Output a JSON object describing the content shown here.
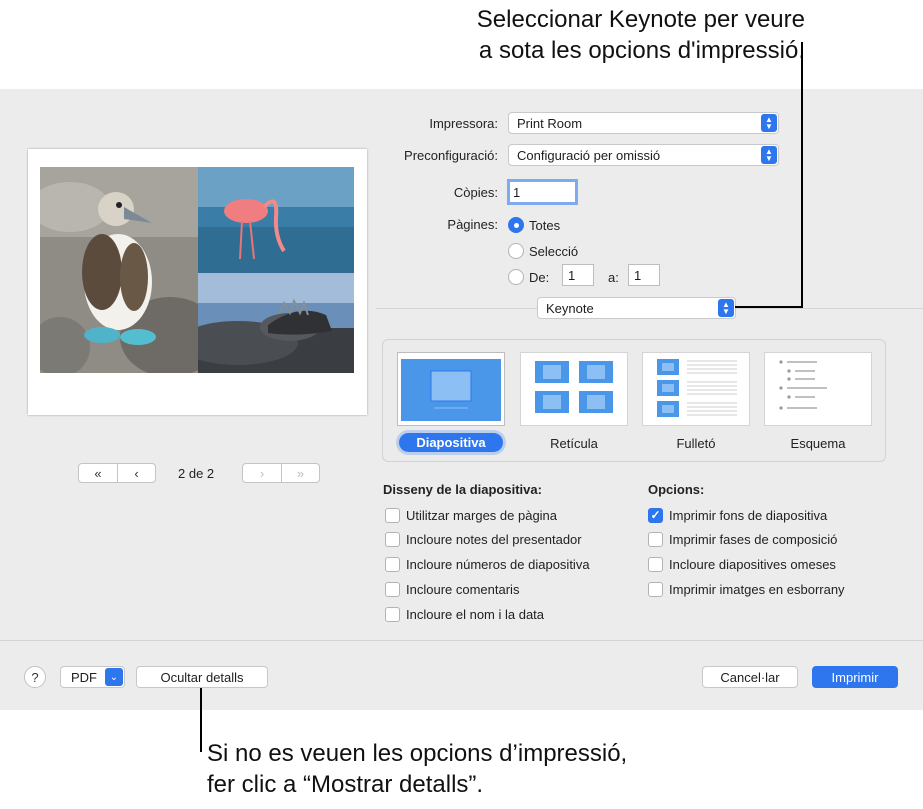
{
  "callouts": {
    "top_line1": "Seleccionar Keynote per veure",
    "top_line2": "a sota les opcions d'impressió.",
    "bottom_line1": "Si no es veuen les opcions d’impressió,",
    "bottom_line2": "fer clic a “Mostrar detalls”."
  },
  "preview": {
    "page_indicator": "2 de 2",
    "first_label": "«",
    "prev_label": "‹",
    "next_label": "›",
    "last_label": "»"
  },
  "settings": {
    "printer_label": "Impressora:",
    "printer_value": "Print Room",
    "preset_label": "Preconfiguració:",
    "preset_value": "Configuració per omissió",
    "copies_label": "Còpies:",
    "copies_value": "1",
    "pages_label": "Pàgines:",
    "pages_all": "Totes",
    "pages_selection": "Selecció",
    "pages_from": "De:",
    "from_value": "1",
    "pages_to": "a:",
    "to_value": "1",
    "app_menu_value": "Keynote"
  },
  "layouts": {
    "items": [
      {
        "label": "Diapositiva",
        "selected": true
      },
      {
        "label": "Retícula",
        "selected": false
      },
      {
        "label": "Fulletó",
        "selected": false
      },
      {
        "label": "Esquema",
        "selected": false
      }
    ]
  },
  "slide_design": {
    "title": "Disseny de la diapositiva:",
    "options": [
      {
        "label": "Utilitzar marges de pàgina",
        "checked": false
      },
      {
        "label": "Incloure notes del presentador",
        "checked": false
      },
      {
        "label": "Incloure números de diapositiva",
        "checked": false
      },
      {
        "label": "Incloure comentaris",
        "checked": false
      },
      {
        "label": "Incloure el nom i la data",
        "checked": false
      }
    ]
  },
  "options": {
    "title": "Opcions:",
    "items": [
      {
        "label": "Imprimir fons de diapositiva",
        "checked": true
      },
      {
        "label": "Imprimir fases de composició",
        "checked": false
      },
      {
        "label": "Incloure diapositives omeses",
        "checked": false
      },
      {
        "label": "Imprimir imatges en esborrany",
        "checked": false
      }
    ]
  },
  "footer": {
    "help_label": "?",
    "pdf_label": "PDF",
    "hide_details_label": "Ocultar detalls",
    "cancel_label": "Cancel·lar",
    "print_label": "Imprimir"
  },
  "colors": {
    "accent": "#2d76ee",
    "dialog_bg": "#ececec"
  }
}
